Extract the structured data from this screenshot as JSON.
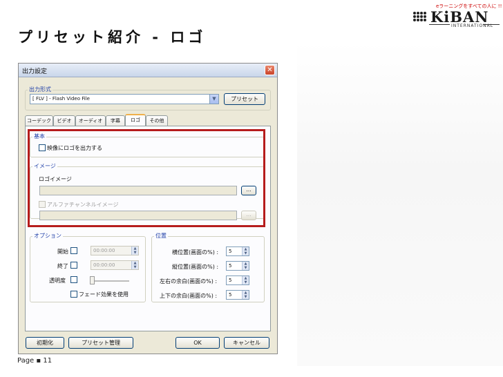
{
  "slide": {
    "title": "プリセット紹介 - ロゴ",
    "page": "Page ▪ 11"
  },
  "logo": {
    "tagline": "eラーニングをすべての人に !!",
    "name": "KiBAN",
    "sub": "INTERNATIONAL"
  },
  "dialog": {
    "title": "出力設定",
    "close": "✕",
    "output_format": {
      "group_label": "出力形式",
      "selected": "[ FLV ] - Flash Video File",
      "preset_button": "プリセット"
    },
    "tabs": [
      {
        "label": "コーデック"
      },
      {
        "label": "ビデオ"
      },
      {
        "label": "オーディオ"
      },
      {
        "label": "字幕"
      },
      {
        "label": "ロゴ"
      },
      {
        "label": "その他"
      }
    ],
    "basic": {
      "group_label": "基本",
      "output_logo_checkbox": "映像にロゴを出力する"
    },
    "image": {
      "group_label": "イメージ",
      "logo_image_label": "ロゴイメージ",
      "browse": "...",
      "alpha_checkbox": "アルファチャンネルイメージ",
      "alpha_browse": "..."
    },
    "options": {
      "group_label": "オプション",
      "start_label": "開始",
      "start_value": "00:00:00",
      "end_label": "終了",
      "end_value": "00:00:00",
      "opacity_label": "透明度",
      "fade_label": "フェード効果を使用"
    },
    "position": {
      "group_label": "位置",
      "rows": [
        {
          "label": "横位置(画面の%) :",
          "value": "5"
        },
        {
          "label": "縦位置(画面の%) :",
          "value": "5"
        },
        {
          "label": "左右の余白(画面の%) :",
          "value": "5"
        },
        {
          "label": "上下の余白(画面の%) :",
          "value": "5"
        }
      ]
    },
    "buttons": {
      "reset": "初期化",
      "preset_manage": "プリセット管理",
      "ok": "OK",
      "cancel": "キャンセル"
    }
  }
}
